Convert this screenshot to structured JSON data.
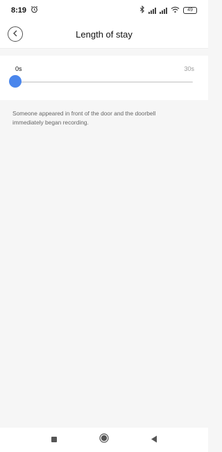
{
  "status_bar": {
    "time": "8:19",
    "battery": "49",
    "icons": [
      "alarm-icon",
      "bluetooth-icon",
      "signal-icon",
      "signal-icon",
      "wifi-icon",
      "battery-icon"
    ]
  },
  "header": {
    "title": "Length of stay",
    "back_icon": "chevron-left-icon"
  },
  "slider": {
    "min_label": "0s",
    "max_label": "30s",
    "value_fraction": 0.0,
    "accent_color": "#4a86ec"
  },
  "description": "Someone appeared in front of the door and the doorbell immediately began recording.",
  "nav_bar": {
    "icons": [
      "recents-square-icon",
      "home-circle-icon",
      "back-triangle-icon"
    ]
  }
}
